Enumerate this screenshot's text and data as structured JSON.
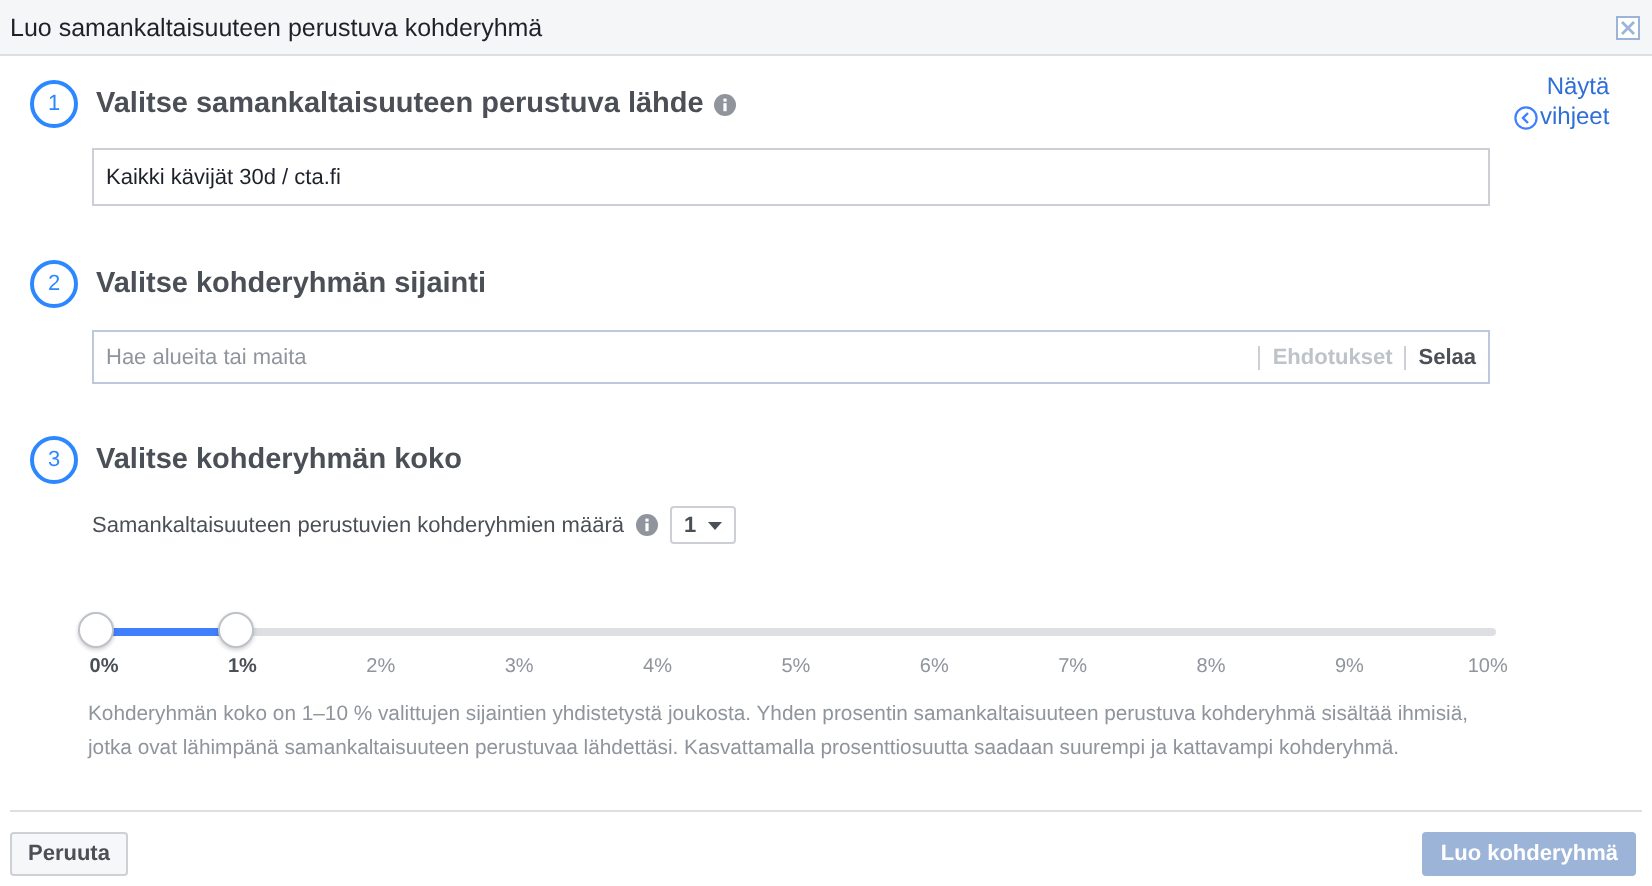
{
  "window": {
    "title": "Luo samankaltaisuuteen perustuva kohderyhmä"
  },
  "hint_link": {
    "label_top": "Näytä",
    "label_bottom": "vihjeet"
  },
  "steps": [
    {
      "number": "1",
      "title": "Valitse samankaltaisuuteen perustuva lähde",
      "info": true,
      "kind": "source",
      "field": {
        "value": "Kaikki kävijät 30d / cta.fi"
      }
    },
    {
      "number": "2",
      "title": "Valitse kohderyhmän sijainti",
      "info": false,
      "kind": "location",
      "field": {
        "placeholder": "Hae alueita tai maita",
        "suggest": "Ehdotukset",
        "browse": "Selaa"
      }
    },
    {
      "number": "3",
      "title": "Valitse kohderyhmän koko",
      "info": false,
      "kind": "size",
      "count_label": "Samankaltaisuuteen perustuvien kohderyhmien määrä",
      "count_value": "1",
      "slider": {
        "level": 0.1,
        "ticks": [
          {
            "label": "0%",
            "active": true
          },
          {
            "label": "1%",
            "active": true
          },
          {
            "label": "2%",
            "active": false
          },
          {
            "label": "3%",
            "active": false
          },
          {
            "label": "4%",
            "active": false
          },
          {
            "label": "5%",
            "active": false
          },
          {
            "label": "6%",
            "active": false
          },
          {
            "label": "7%",
            "active": false
          },
          {
            "label": "8%",
            "active": false
          },
          {
            "label": "9%",
            "active": false
          },
          {
            "label": "10%",
            "active": false
          }
        ]
      },
      "description": "Kohderyhmän koko on 1–10 % valittujen sijaintien yhdistetystä joukosta. Yhden prosentin samankaltaisuuteen perustuva kohderyhmä sisältää ihmisiä, jotka ovat lähimpänä samankaltaisuuteen perustuvaa lähdettäsi. Kasvattamalla prosenttiosuutta saadaan suurempi ja kattavampi kohderyhmä."
    }
  ],
  "footer": {
    "cancel": {
      "label": "Peruuta",
      "disabled": false
    },
    "create": {
      "label": "Luo kohderyhmä",
      "disabled": true
    }
  }
}
